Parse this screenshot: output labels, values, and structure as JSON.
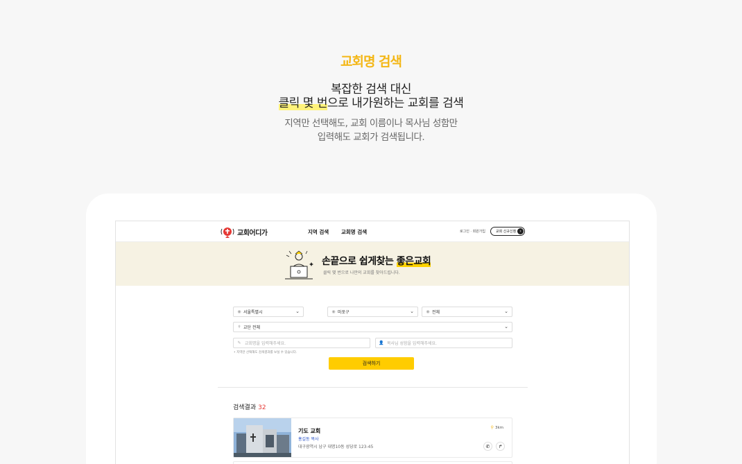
{
  "hero": {
    "kicker": "교회명 검색",
    "title_line1": "복잡한 검색 대신",
    "title_line2_highlight": "클릭 몇 번",
    "title_line2_rest": "으로 내가원하는 교회를 검색",
    "desc_line1": "지역만 선택해도, 교회 이름이나 목사님 성함만",
    "desc_line2": "입력해도 교회가 검색됩니다."
  },
  "nav": {
    "logo": "교회어디가",
    "links": [
      "지역 검색",
      "교회명 검색"
    ],
    "login": "로그인 · 회원가입",
    "apply": "교회 신규신청"
  },
  "banner": {
    "title_pre": "손끝으로 쉽게찾는 ",
    "title_highlight": "좋은교회",
    "subtitle": "클릭 몇 번으로 나만의 교회를 찾아드립니다."
  },
  "form": {
    "city": "서울특별시",
    "district": "마포구",
    "area": "전체",
    "denomination": "교단 전체",
    "church_placeholder": "교회명을 입력해주세요.",
    "pastor_placeholder": "목사님 성함을 입력해주세요.",
    "hint": "• 지역만 선택해도 검색결과를 보실 수 있습니다.",
    "search_button": "검색하기"
  },
  "results": {
    "label": "검색결과",
    "count": "32",
    "items": [
      {
        "name": "기도 교회",
        "pastor": "홍길동 목사",
        "address": "대구광역시 남구 대명10동 성당로 123-45",
        "distance": "3km"
      }
    ]
  },
  "colors": {
    "accent": "#f4b716",
    "button": "#ffcc00",
    "count": "#e53935",
    "pastor": "#2f57c9",
    "banner_bg": "#f6f2e3"
  }
}
